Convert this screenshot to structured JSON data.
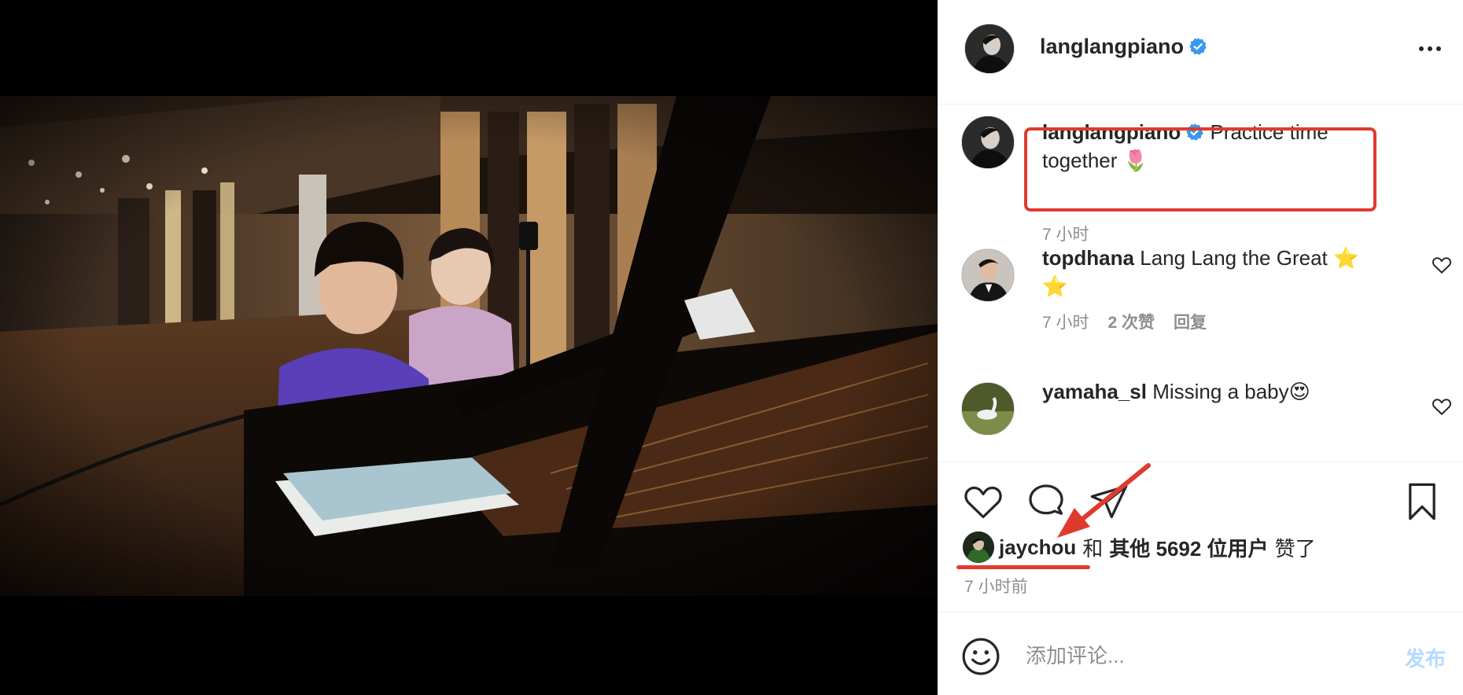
{
  "post": {
    "username": "langlangpiano",
    "colors": {
      "accent": "#3897f0",
      "highlight": "#e03a2f",
      "muted": "#8e8e8e"
    }
  },
  "comments": [
    {
      "username": "langlangpiano",
      "text": "Practice time together 🌷",
      "time": "7 小时",
      "verified": true
    },
    {
      "username": "topdhana",
      "text": "Lang Lang the Great ⭐ ⭐",
      "time": "7 小时",
      "likes": "2 次赞",
      "reply": "回复"
    },
    {
      "username": "yamaha_sl",
      "text": "Missing a baby😍"
    }
  ],
  "likes": {
    "user": "jaychou",
    "conj": "和",
    "others": "其他 5692 位用户",
    "suffix": "赞了"
  },
  "timestamp": "7 小时前",
  "composer": {
    "placeholder": "添加评论...",
    "post_label": "发布"
  }
}
